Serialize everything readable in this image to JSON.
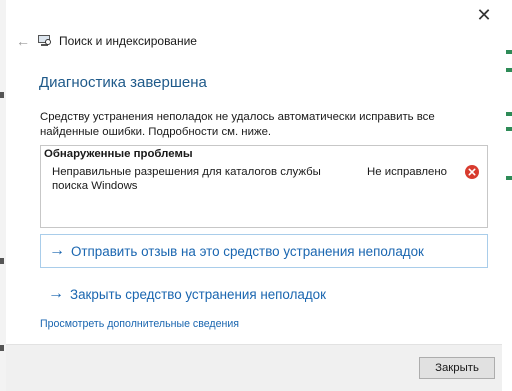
{
  "window": {
    "close_glyph": "✕"
  },
  "nav": {
    "back_glyph": "←",
    "title": "Поиск и индексирование"
  },
  "main": {
    "heading": "Диагностика завершена",
    "description": "Средству устранения неполадок не удалось автоматически исправить все найденные ошибки. Подробности см. ниже.",
    "problems": {
      "header": "Обнаруженные проблемы",
      "items": [
        {
          "text": "Неправильные разрешения для каталогов службы поиска Windows",
          "status": "Не исправлено",
          "status_icon": "error-icon",
          "status_color": "#d83b2e"
        }
      ]
    },
    "links": [
      {
        "arrow": "→",
        "label": "Отправить отзыв на это средство устранения неполадок"
      },
      {
        "arrow": "→",
        "label": "Закрыть средство устранения неполадок"
      }
    ],
    "more_info_link": "Просмотреть дополнительные сведения"
  },
  "footer": {
    "close_button": "Закрыть"
  },
  "colors": {
    "accent": "#1a66b0",
    "heading": "#1f5a8a",
    "footer_bg": "#f0f0f0"
  }
}
